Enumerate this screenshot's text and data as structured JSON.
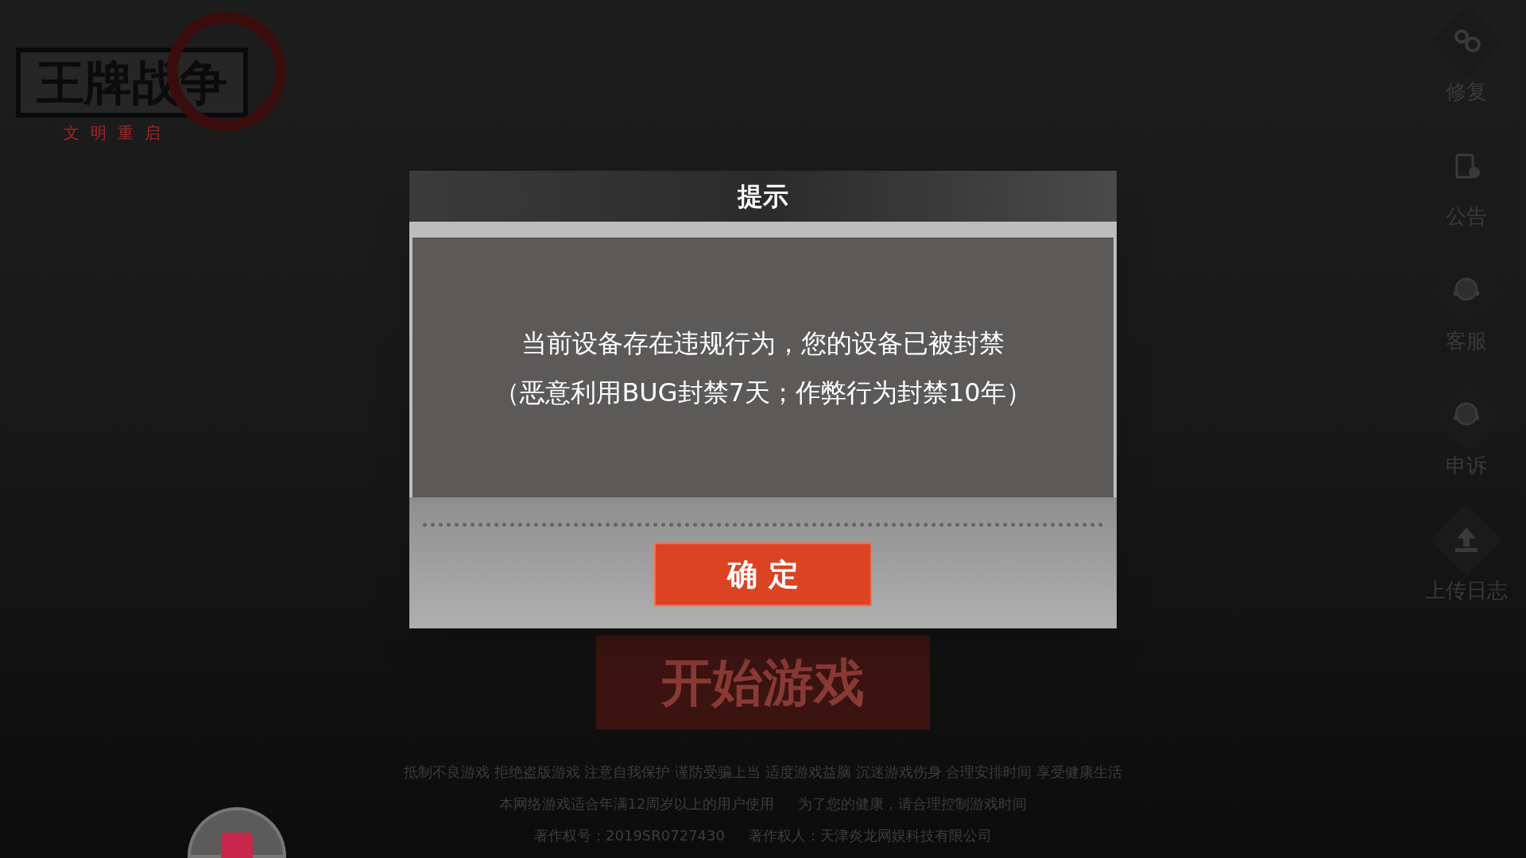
{
  "logo": {
    "title": "王牌战争",
    "subtitle": "文明重启"
  },
  "side_menu": [
    {
      "label": "修复",
      "kind": "gears"
    },
    {
      "label": "公告",
      "kind": "notice"
    },
    {
      "label": "客服",
      "kind": "headset"
    },
    {
      "label": "申诉",
      "kind": "headset"
    },
    {
      "label": "上传日志",
      "kind": "upload"
    }
  ],
  "start_button": "开始游戏",
  "notices": [
    [
      "抵制不良游戏 拒绝盗版游戏 注意自我保护 谨防受骗上当 适度游戏益脑 沉迷游戏伤身 合理安排时间 享受健康生活"
    ],
    [
      "本网络游戏适合年满12周岁以上的用户使用",
      "为了您的健康，请合理控制游戏时间"
    ],
    [
      "著作权号：2019SR0727430",
      "著作权人：天津炎龙网娱科技有限公司"
    ]
  ],
  "dialog": {
    "title": "提示",
    "message": [
      "当前设备存在违规行为，您的设备已被封禁",
      "（恶意利用BUG封禁7天；作弊行为封禁10年）"
    ],
    "confirm": "确 定"
  }
}
